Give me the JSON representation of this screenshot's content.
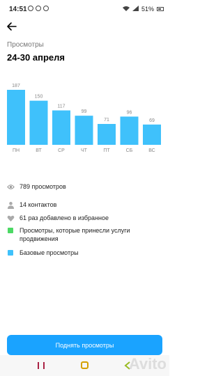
{
  "status_bar": {
    "time": "14:51",
    "battery": "51%"
  },
  "header": {
    "section_label": "Просмотры",
    "period": "24-30 апреля"
  },
  "chart_data": {
    "type": "bar",
    "categories": [
      "ПН",
      "ВТ",
      "СР",
      "ЧТ",
      "ПТ",
      "СБ",
      "ВС"
    ],
    "values": [
      187,
      150,
      117,
      99,
      71,
      96,
      69
    ],
    "ylim": [
      0,
      187
    ],
    "bar_color": "#3fc1fb",
    "grid": false
  },
  "stats": {
    "views": "789 просмотров",
    "contacts": "14 контактов",
    "favorites": "61 раз добавлено в избранное"
  },
  "legend": {
    "promoted": {
      "label": "Просмотры, которые принесли услуги продвижения",
      "color": "#4cd964"
    },
    "base": {
      "label": "Базовые просмотры",
      "color": "#3fc1fb"
    }
  },
  "cta": {
    "label": "Поднять просмотры"
  },
  "colors": {
    "accent": "#1aa3ff"
  }
}
